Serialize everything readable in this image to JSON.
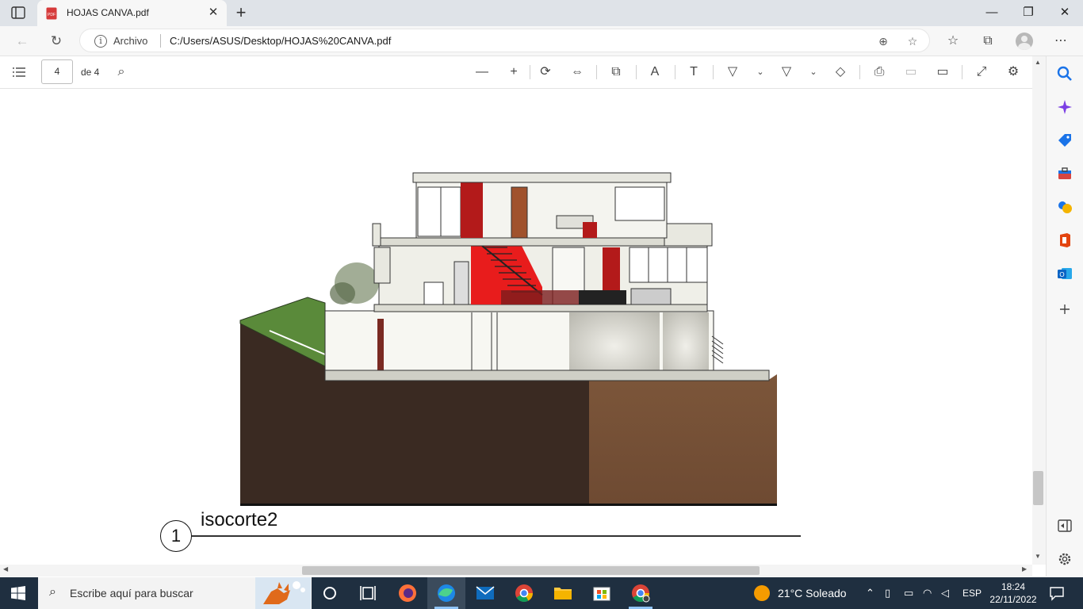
{
  "browser": {
    "tab": {
      "title": "HOJAS CANVA.pdf",
      "close": "✕"
    },
    "new_tab": "+",
    "window_controls": {
      "minimize": "—",
      "restore": "❐",
      "close": "✕"
    },
    "address": {
      "site_label": "Archivo",
      "url": "C:/Users/ASUS/Desktop/HOJAS%20CANVA.pdf"
    }
  },
  "pdf_toolbar": {
    "page_current": "4",
    "page_total": "de 4"
  },
  "document": {
    "section_number": "1",
    "section_title": "isocorte2"
  },
  "taskbar": {
    "search_placeholder": "Escribe aquí para buscar",
    "weather": "21°C  Soleado",
    "language": "ESP",
    "time": "18:24",
    "date": "22/11/2022"
  },
  "colors": {
    "accent_blue": "#0067c0",
    "taskbar": "#1f2f40",
    "stair_red": "#e81c1c",
    "soil_dark": "#3a2a22",
    "soil_brown": "#7a5438",
    "grass": "#5a8a3a"
  }
}
